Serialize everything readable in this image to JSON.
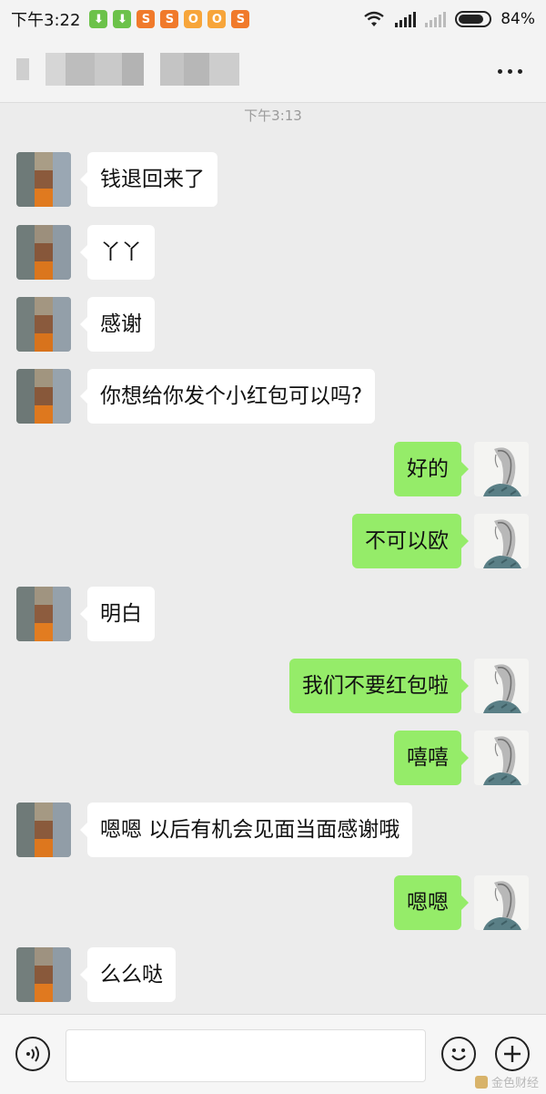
{
  "status_bar": {
    "time": "下午3:22",
    "notification_icons": [
      {
        "name": "download-icon",
        "glyph": "⬇",
        "color": "#6cc24a"
      },
      {
        "name": "download-icon",
        "glyph": "⬇",
        "color": "#6cc24a"
      },
      {
        "name": "weibo-icon",
        "glyph": "S",
        "color": "#f07a2b"
      },
      {
        "name": "weibo-icon",
        "glyph": "S",
        "color": "#f07a2b"
      },
      {
        "name": "taobao-icon",
        "glyph": "O",
        "color": "#f7a53a"
      },
      {
        "name": "taobao-icon",
        "glyph": "O",
        "color": "#f7a53a"
      },
      {
        "name": "weibo-icon",
        "glyph": "S",
        "color": "#f07a2b"
      }
    ],
    "battery_percent": "84%",
    "battery_level": 0.84
  },
  "chat": {
    "timestamp": "下午3:13",
    "messages": [
      {
        "side": "in",
        "text": "钱退回来了"
      },
      {
        "side": "in",
        "text": "丫丫"
      },
      {
        "side": "in",
        "text": "感谢"
      },
      {
        "side": "in",
        "text": "你想给你发个小红包可以吗?"
      },
      {
        "side": "out",
        "text": "好的"
      },
      {
        "side": "out",
        "text": "不可以欧"
      },
      {
        "side": "in",
        "text": "明白"
      },
      {
        "side": "out",
        "text": "我们不要红包啦"
      },
      {
        "side": "out",
        "text": "嘻嘻"
      },
      {
        "side": "in",
        "text": "嗯嗯  以后有机会见面当面感谢哦"
      },
      {
        "side": "out",
        "text": "嗯嗯"
      },
      {
        "side": "in",
        "text": "么么哒"
      }
    ]
  },
  "input_bar": {
    "voice_icon": "voice-icon",
    "emoji_icon": "emoji-icon",
    "plus_icon": "plus-icon",
    "message_value": ""
  },
  "watermark": {
    "text": "金色财经"
  },
  "colors": {
    "bubble_out": "#95ec69",
    "bubble_in": "#ffffff",
    "background": "#ececec"
  }
}
